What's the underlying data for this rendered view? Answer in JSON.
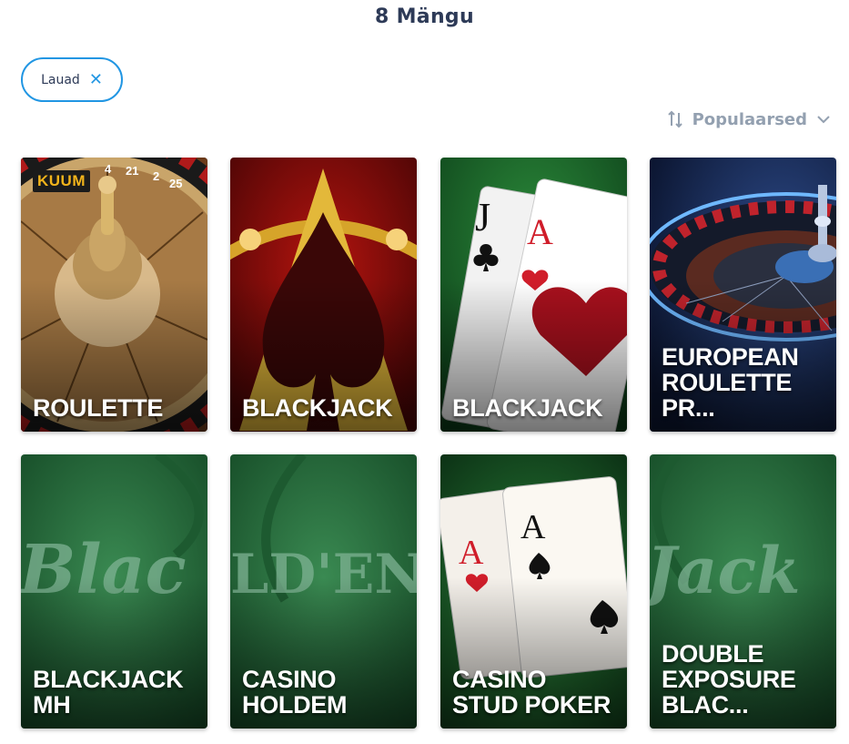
{
  "header": {
    "title": "8 Mängu"
  },
  "filters": {
    "active_chip": "Lauad"
  },
  "sort": {
    "label": "Populaarsed"
  },
  "games": [
    {
      "name": "ROULETTE",
      "badge": "KUUM"
    },
    {
      "name": "BLACKJACK"
    },
    {
      "name": "BLACKJACK"
    },
    {
      "name": "EUROPEAN ROULETTE PR..."
    },
    {
      "name": "BLACKJACK MH"
    },
    {
      "name": "CASINO HOLDEM"
    },
    {
      "name": "CASINO STUD POKER"
    },
    {
      "name": "DOUBLE EXPOSURE BLAC..."
    }
  ],
  "card_art_text": {
    "c1_numbers": [
      "4",
      "21",
      "2",
      "25"
    ],
    "c3_cards": [
      "J",
      "A"
    ],
    "c5_text": "Blac",
    "c6_text": "LD'EN",
    "c7_cards": [
      "A",
      "A"
    ],
    "c8_text": "Jack"
  },
  "colors": {
    "accent": "#2196e3",
    "title": "#2d3a57",
    "sort": "#93a0b0",
    "badge_bg": "#1b1b1b",
    "badge_fg": "#f2b41b"
  }
}
